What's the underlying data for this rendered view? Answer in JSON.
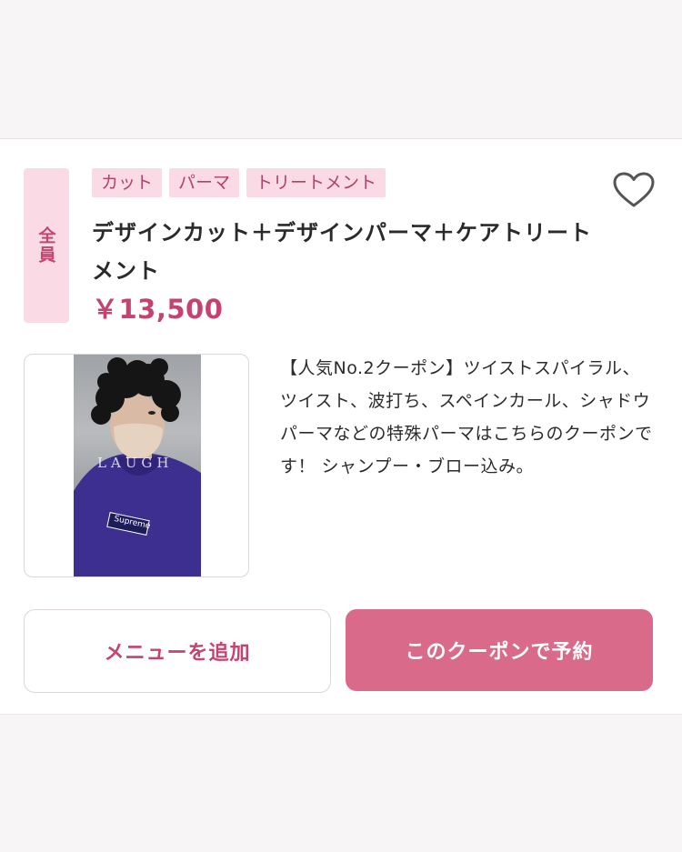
{
  "coupon": {
    "audience_label": "全員",
    "tags": [
      "カット",
      "パーマ",
      "トリートメント"
    ],
    "title": "デザインカット＋デザインパーマ＋ケアトリートメント",
    "price": "￥13,500",
    "description": "【人気No.2クーポン】ツイストスパイラル、ツイスト、波打ち、スペインカール、シャドウパーマなどの特殊パーマはこちらのクーポンです！ シャンプー・ブロー込み。",
    "image": {
      "watermark": "LAUGH",
      "shirt_logo": "Supreme"
    }
  },
  "actions": {
    "add_menu_label": "メニューを追加",
    "book_label": "このクーポンで予約"
  },
  "colors": {
    "accent": "#c7436f",
    "tag_bg": "#fadbe5",
    "book_button": "#d96a89"
  },
  "icons": {
    "favorite": "heart-icon",
    "gallery": "multiple-images-icon"
  }
}
